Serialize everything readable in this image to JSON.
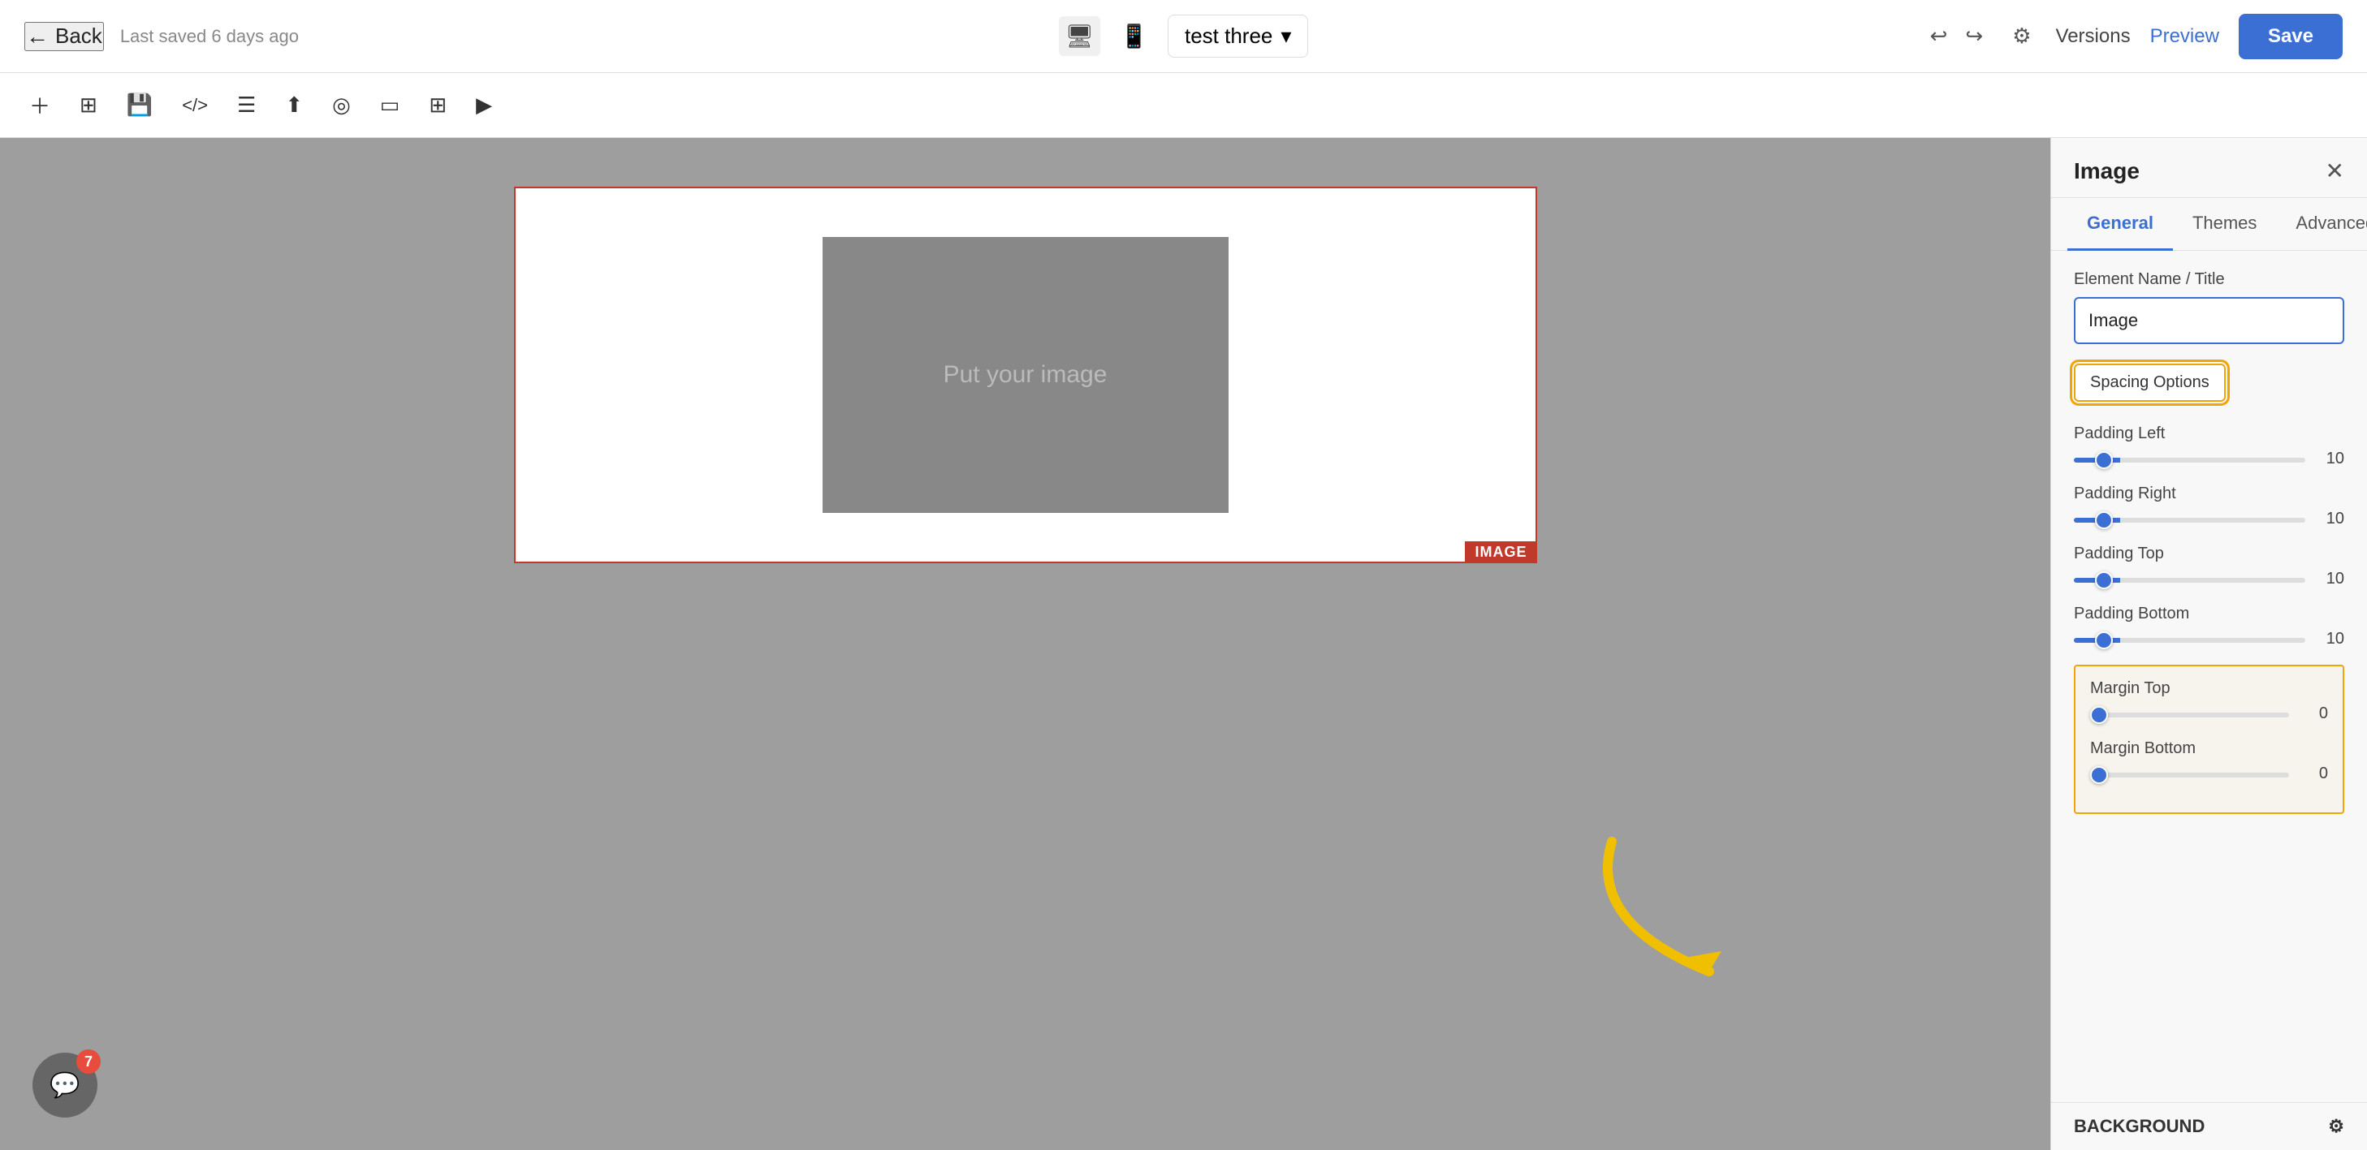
{
  "topbar": {
    "back_label": "Back",
    "last_saved": "Last saved 6 days ago",
    "project_name": "test three",
    "versions_label": "Versions",
    "preview_label": "Preview",
    "save_label": "Save"
  },
  "toolbar": {
    "icons": [
      {
        "name": "add-icon",
        "symbol": "+"
      },
      {
        "name": "layers-icon",
        "symbol": "⊞"
      },
      {
        "name": "save-file-icon",
        "symbol": "💾"
      },
      {
        "name": "code-icon",
        "symbol": "</>"
      },
      {
        "name": "layout-icon",
        "symbol": "⊡"
      },
      {
        "name": "export-icon",
        "symbol": "↑"
      },
      {
        "name": "component-icon",
        "symbol": "◎"
      },
      {
        "name": "frame-icon",
        "symbol": "▭"
      },
      {
        "name": "grid-icon",
        "symbol": "⊞"
      },
      {
        "name": "publish-icon",
        "symbol": "▶"
      }
    ]
  },
  "canvas": {
    "image_placeholder_text": "Put your image",
    "image_label": "IMAGE"
  },
  "panel": {
    "title": "Image",
    "tabs": [
      {
        "label": "General",
        "active": true
      },
      {
        "label": "Themes",
        "active": false
      },
      {
        "label": "Advanced",
        "active": false
      }
    ],
    "element_name_label": "Element Name / Title",
    "element_name_value": "Image",
    "spacing_options_label": "Spacing Options",
    "padding_left_label": "Padding Left",
    "padding_left_value": "10",
    "padding_right_label": "Padding Right",
    "padding_right_value": "10",
    "padding_top_label": "Padding Top",
    "padding_top_value": "10",
    "padding_bottom_label": "Padding Bottom",
    "padding_bottom_value": "10",
    "margin_top_label": "Margin Top",
    "margin_top_value": "0",
    "margin_bottom_label": "Margin Bottom",
    "margin_bottom_value": "0",
    "background_label": "BACKGROUND"
  },
  "chat": {
    "badge_count": "7"
  },
  "colors": {
    "accent_blue": "#3b6fd4",
    "accent_orange": "#f0a500",
    "red_border": "#c0392b"
  }
}
